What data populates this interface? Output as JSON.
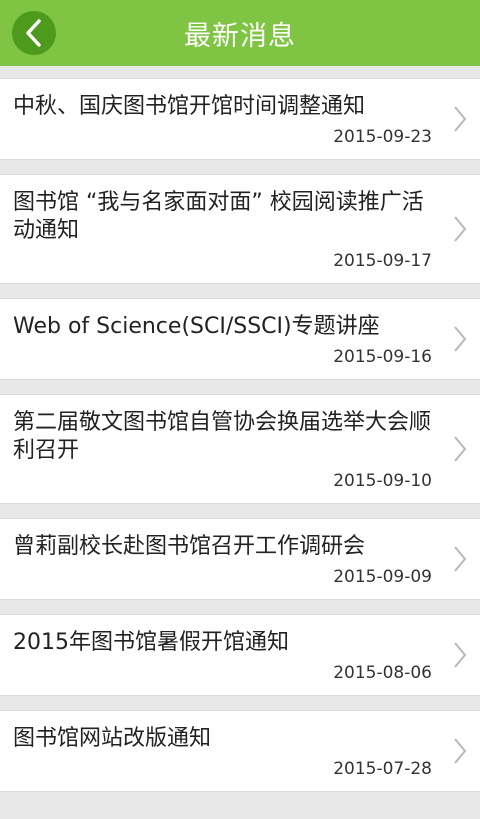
{
  "header": {
    "title": "最新消息"
  },
  "icons": {
    "back": "chevron-left-icon",
    "item_arrow": "chevron-right-icon"
  },
  "colors": {
    "header": "#7fc443",
    "back_button": "#4e9a1c"
  },
  "news": [
    {
      "title": "中秋、国庆图书馆开馆时间调整通知",
      "date": "2015-09-23"
    },
    {
      "title": "图书馆 “我与名家面对面” 校园阅读推广活动通知",
      "date": "2015-09-17"
    },
    {
      "title": "Web of Science(SCI/SSCI)专题讲座",
      "date": "2015-09-16"
    },
    {
      "title": "第二届敬文图书馆自管协会换届选举大会顺利召开",
      "date": "2015-09-10"
    },
    {
      "title": "曾莉副校长赴图书馆召开工作调研会",
      "date": "2015-09-09"
    },
    {
      "title": "2015年图书馆暑假开馆通知",
      "date": "2015-08-06"
    },
    {
      "title": "图书馆网站改版通知",
      "date": "2015-07-28"
    }
  ]
}
